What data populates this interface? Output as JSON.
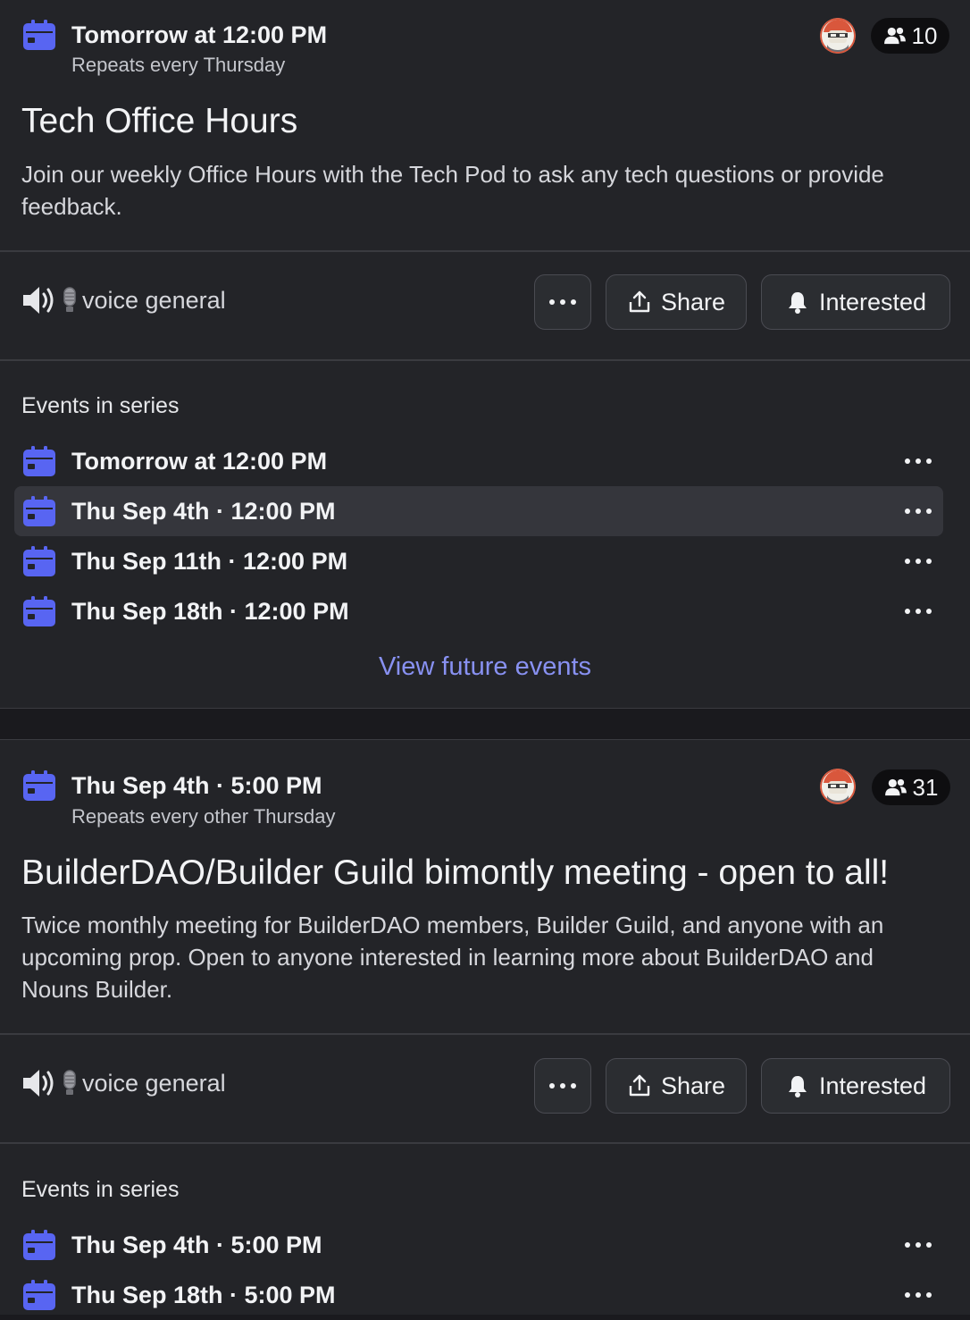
{
  "colors": {
    "accent": "#5865f2",
    "link": "#8891f2",
    "background": "#1a1a1e",
    "card": "#232428"
  },
  "events": [
    {
      "when": "Tomorrow at 12:00 PM",
      "repeats": "Repeats every Thursday",
      "interested_count": "10",
      "title": "Tech Office Hours",
      "description": "Join our weekly Office Hours with the Tech Pod to ask any tech questions or provide feedback.",
      "location": "voice general",
      "location_icon": "speaker-icon",
      "buttons": {
        "more": "more-options",
        "share": "Share",
        "interested": "Interested"
      },
      "series_heading": "Events in series",
      "series": [
        {
          "label": "Tomorrow at 12:00 PM"
        },
        {
          "label": "Thu Sep 4th · 12:00 PM"
        },
        {
          "label": "Thu Sep 11th · 12:00 PM"
        },
        {
          "label": "Thu Sep 18th · 12:00 PM"
        }
      ],
      "view_future": "View future events"
    },
    {
      "when": "Thu Sep 4th · 5:00 PM",
      "repeats": "Repeats every other Thursday",
      "interested_count": "31",
      "title": "BuilderDAO/Builder Guild bimontly meeting - open to all!",
      "description": "Twice monthly meeting for BuilderDAO members, Builder Guild, and anyone with an upcoming prop. Open to anyone interested in learning more about BuilderDAO and Nouns Builder.",
      "location": "voice general",
      "location_icon": "speaker-icon",
      "buttons": {
        "more": "more-options",
        "share": "Share",
        "interested": "Interested"
      },
      "series_heading": "Events in series",
      "series": [
        {
          "label": "Thu Sep 4th · 5:00 PM"
        },
        {
          "label": "Thu Sep 18th · 5:00 PM"
        }
      ]
    }
  ]
}
